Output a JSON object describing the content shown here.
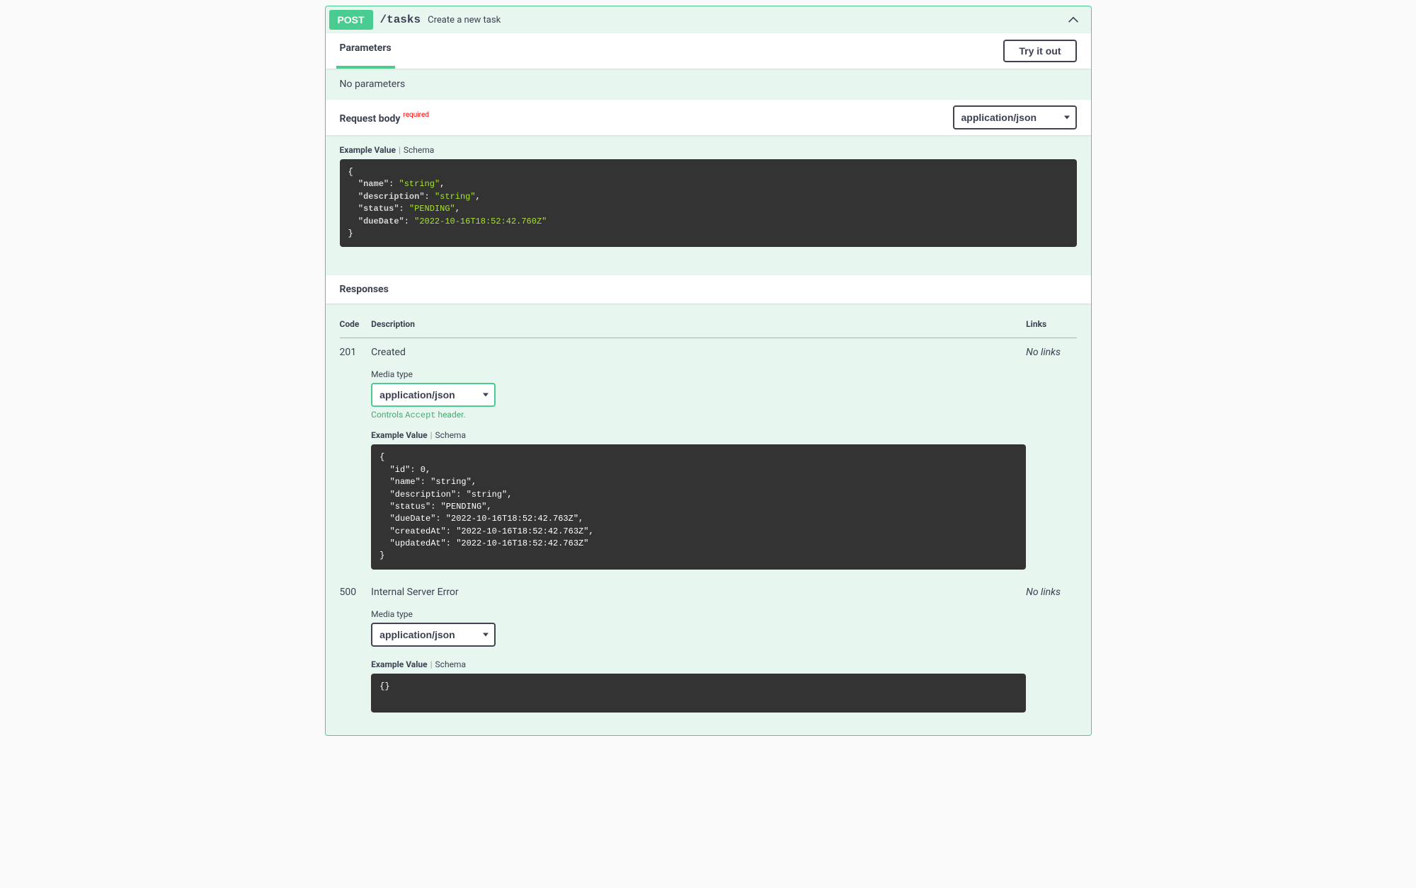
{
  "summary": {
    "method": "POST",
    "path": "/tasks",
    "description": "Create a new task"
  },
  "parameters": {
    "tab_label": "Parameters",
    "try_label": "Try it out",
    "empty_text": "No parameters"
  },
  "request_body": {
    "title": "Request body",
    "required_label": "required",
    "content_type": "application/json",
    "tabs": {
      "example": "Example Value",
      "schema": "Schema"
    },
    "example_json": {
      "name": "string",
      "description": "string",
      "status": "PENDING",
      "dueDate": "2022-10-16T18:52:42.760Z"
    }
  },
  "responses_section": {
    "header": "Responses",
    "columns": {
      "code": "Code",
      "description": "Description",
      "links": "Links"
    },
    "no_links": "No links",
    "media_type_label": "Media type",
    "content_type": "application/json",
    "accept_note_prefix": "Controls ",
    "accept_note_code": "Accept",
    "accept_note_suffix": " header.",
    "tabs": {
      "example": "Example Value",
      "schema": "Schema"
    },
    "rows": [
      {
        "code": "201",
        "description": "Created",
        "has_accept_note": true,
        "example_json": {
          "id": 0,
          "name": "string",
          "description": "string",
          "status": "PENDING",
          "dueDate": "2022-10-16T18:52:42.763Z",
          "createdAt": "2022-10-16T18:52:42.763Z",
          "updatedAt": "2022-10-16T18:52:42.763Z"
        }
      },
      {
        "code": "500",
        "description": "Internal Server Error",
        "has_accept_note": false,
        "example_json": {}
      }
    ]
  }
}
